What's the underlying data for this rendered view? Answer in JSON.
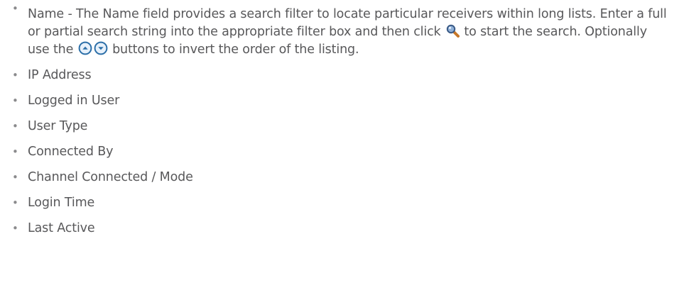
{
  "icons": {
    "search": "magnifier-search-icon",
    "sort_up": "sort-ascending-icon",
    "sort_down": "sort-descending-icon"
  },
  "colors": {
    "text": "#58585a",
    "bullet": "#8a8a8c",
    "sort_icon_border": "#2c6fa8",
    "sort_icon_fill": "#e7f1fb",
    "search_icon_lens": "#3a5a86",
    "search_icon_handle": "#c7782a"
  },
  "list": {
    "name_item": {
      "part1": "Name - The Name field provides a search filter to locate particular receivers within long lists. Enter a full or partial search string into the appropriate filter box and then click",
      "part2": "to start the search. Optionally use the",
      "part3": "buttons to invert the order of the listing."
    },
    "items": [
      "IP Address",
      "Logged in User",
      "User Type",
      "Connected By",
      "Channel Connected / Mode",
      "Login Time",
      "Last Active"
    ]
  }
}
